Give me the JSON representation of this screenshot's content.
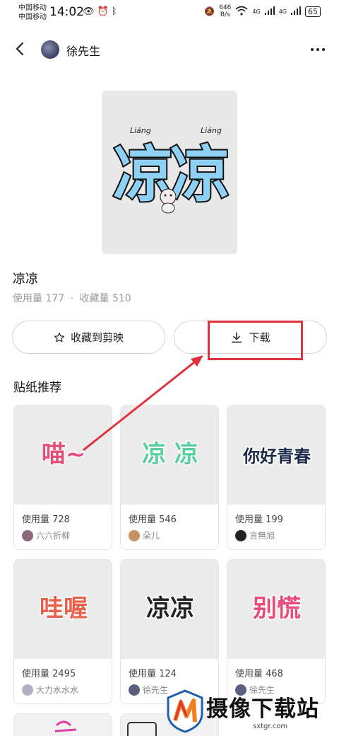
{
  "status_bar": {
    "carrier_1": "中国移动",
    "carrier_2": "中国移动",
    "time": "14:02",
    "net_speed_value": "646",
    "net_speed_unit": "B/s",
    "signal_1": "4G",
    "signal_2": "4G",
    "battery": "65"
  },
  "header": {
    "author_name": "徐先生"
  },
  "sticker": {
    "title": "凉凉",
    "usage_label": "使用量 177",
    "separator": "·",
    "favorites_label": "收藏量 510",
    "art_text": "凉凉",
    "art_pinyin": "Liáng"
  },
  "actions": {
    "favorite_label": "收藏到剪映",
    "download_label": "下载"
  },
  "recommend": {
    "section_title": "贴纸推荐",
    "items": [
      {
        "usage": "使用量 728",
        "creator": "六六折柳",
        "art": "喵~",
        "art_color": "#e0507a",
        "avatar_color": "#8a6a7a"
      },
      {
        "usage": "使用量 546",
        "creator": "朵儿",
        "art": "凉  凉",
        "art_color": "#5ad0a0",
        "avatar_color": "#c89060"
      },
      {
        "usage": "使用量 199",
        "creator": "言無旭",
        "art": "你好青春",
        "art_color": "#1b2a4a",
        "avatar_color": "#222222"
      },
      {
        "usage": "使用量 2495",
        "creator": "大力水水水",
        "art": "哇喔",
        "art_color": "#e8604a",
        "avatar_color": "#b0b0c0"
      },
      {
        "usage": "使用量 124",
        "creator": "徐先生",
        "art": "凉凉",
        "art_color": "#222222",
        "avatar_color": "#5a5f80"
      },
      {
        "usage": "使用量 468",
        "creator": "徐先生",
        "art": "别慌",
        "art_color": "#e84a7a",
        "avatar_color": "#5a5f80"
      }
    ]
  },
  "watermark": {
    "text": "摄像下载站",
    "url": "sxtgr.com"
  }
}
